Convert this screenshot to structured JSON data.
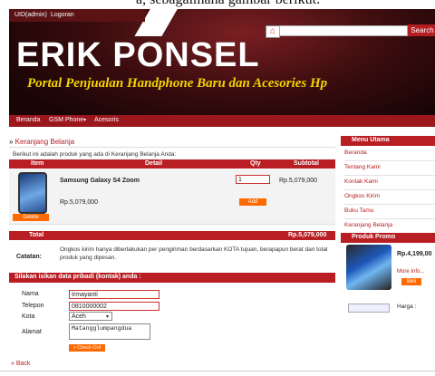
{
  "doc_caption": "a, sebagaimana gambar berikut:",
  "header": {
    "topbar": [
      "UID(admin)",
      "Logoran"
    ],
    "logo": "ERIK PONSEL",
    "tagline": "Portal Penjualan Handphone Baru dan Acesories Hp",
    "search_label": "Search",
    "nav": [
      "Beranda",
      "GSM Phone",
      "Acesoris"
    ]
  },
  "cart": {
    "breadcrumb": "Keranjang Belanja",
    "intro": "Berikut ini adalah produk yang ada di Keranjang Belanja Anda:",
    "columns": [
      "Item",
      "Detail",
      "Qty",
      "Subtotal"
    ],
    "item": {
      "name": "Samsung Galaxy S4 Zoom",
      "price": "Rp.5,079,000",
      "qty": "1",
      "subtotal": "Rp.5,079,000",
      "delete_label": "Delete",
      "add_label": "Add"
    },
    "total_label": "Total",
    "total_value": "Rp.5,079,000",
    "note_label": "Catatan:",
    "note_text": "Ongkos kirim hanya diberlakukan per pengiriman berdasarkan KOTA tujuan, berapapun berat dari total produk yang dipesan."
  },
  "form": {
    "heading": "Silakan isikan data pribadi (kontak) anda :",
    "nama_label": "Nama",
    "nama_value": "Irmayanti",
    "telepon_label": "Telepon",
    "telepon_value": "0810000002",
    "kota_label": "Kota",
    "kota_value": "Aceh",
    "alamat_label": "Alamat",
    "alamat_value": "Matangglumpangdua",
    "checkout_label": "» Check Out"
  },
  "back_label": "« Back",
  "sidebar": {
    "menu_title": "Menu Utama",
    "menu_items": [
      "Beranda",
      "Tentang Kami",
      "Kontak Kami",
      "Ongkos Kirim",
      "Buku Tamu",
      "Keranjang Belanja"
    ],
    "promo_title": "Produk Promo",
    "promo_price": "Rp.4,199,00",
    "promo_more": "More Info...",
    "buy_label": "Beli",
    "harga_label": "Harga :"
  },
  "colors": {
    "accent": "#b81e24",
    "button": "#ff6a00",
    "tagline": "#f5d400"
  }
}
